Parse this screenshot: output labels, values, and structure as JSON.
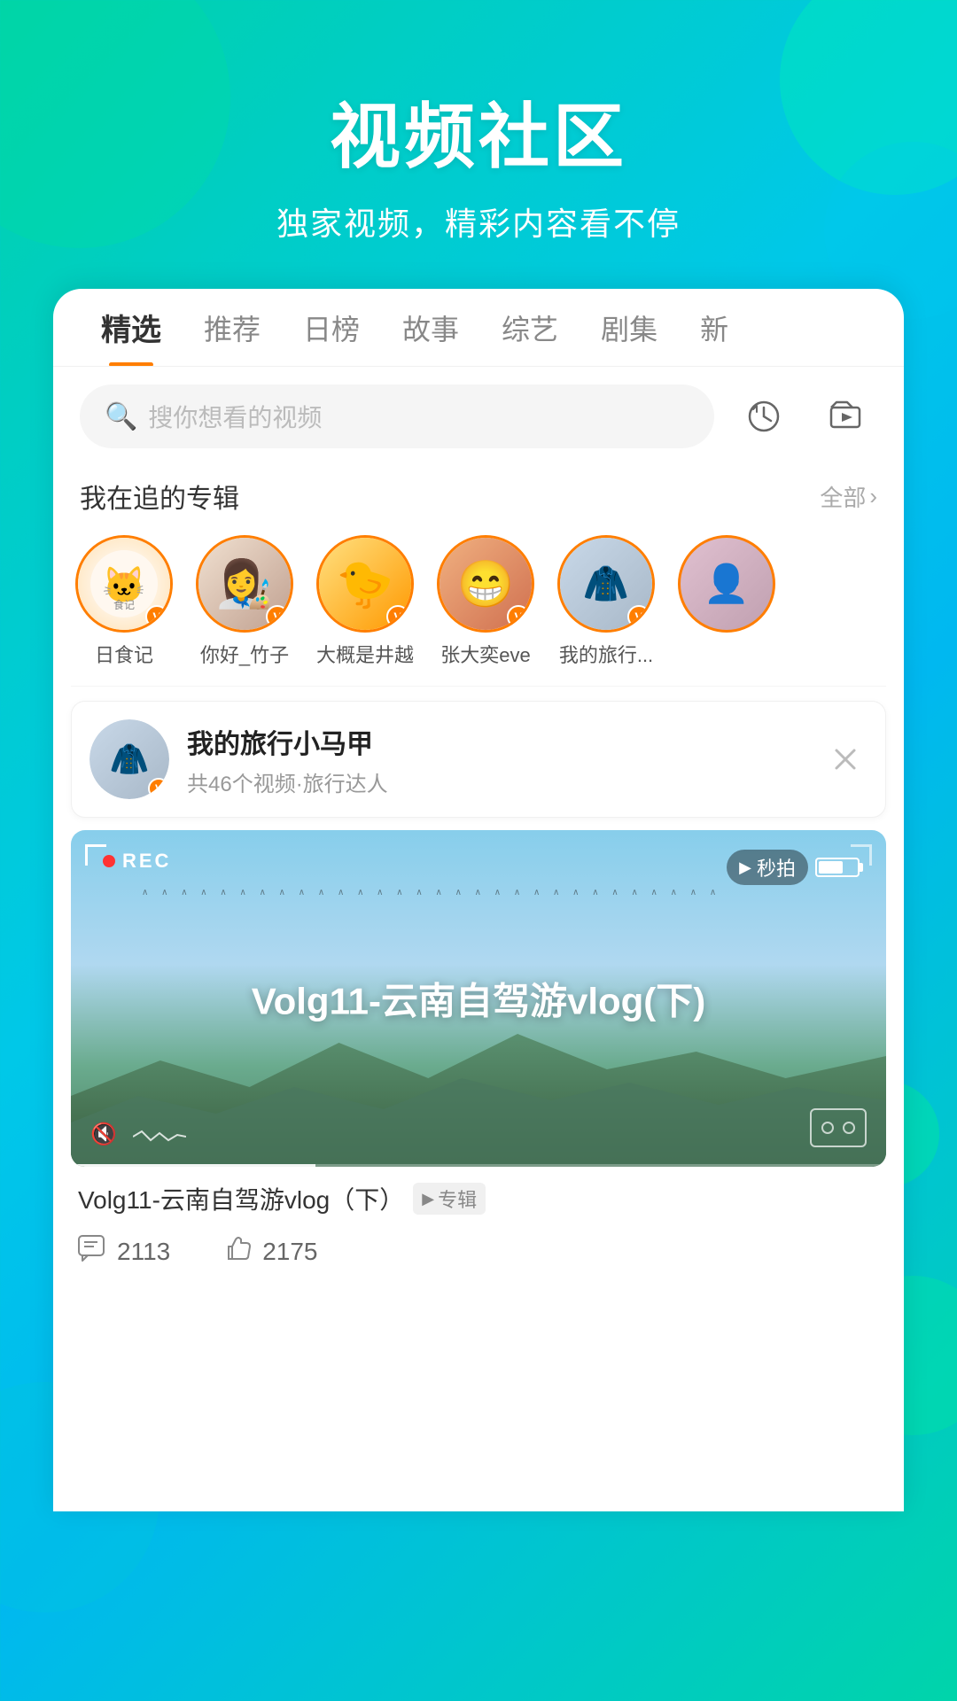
{
  "header": {
    "title": "视频社区",
    "subtitle": "独家视频，精彩内容看不停"
  },
  "tabs": [
    {
      "label": "精选",
      "active": true
    },
    {
      "label": "推荐",
      "active": false
    },
    {
      "label": "日榜",
      "active": false
    },
    {
      "label": "故事",
      "active": false
    },
    {
      "label": "综艺",
      "active": false
    },
    {
      "label": "剧集",
      "active": false
    },
    {
      "label": "新",
      "active": false
    }
  ],
  "search": {
    "placeholder": "搜你想看的视频"
  },
  "section_following": {
    "title": "我在追的专辑",
    "more_label": "全部"
  },
  "avatars": [
    {
      "name": "日食记",
      "emoji": "🐱"
    },
    {
      "name": "你好_竹子",
      "emoji": "👩"
    },
    {
      "name": "大概是井越",
      "emoji": "🐤"
    },
    {
      "name": "张大奕eve",
      "emoji": "😁"
    },
    {
      "name": "我的旅行...",
      "emoji": "🧥"
    }
  ],
  "channel": {
    "name": "我的旅行小马甲",
    "desc": "共46个视频·旅行达人"
  },
  "video": {
    "rec_label": "REC",
    "title_overlay": "Volg11-云南自驾游vlog(下)",
    "title_display": "Volg11-云南自驾游vlog（下）",
    "album_label": "专辑",
    "secondpai": "秒拍",
    "comment_count": "2113",
    "like_count": "2175"
  },
  "icons": {
    "search": "🔍",
    "history": "⏱",
    "video_folder": "📁",
    "close": "✕",
    "play": "▶",
    "comment": "💬",
    "like": "👍",
    "mute": "🔇",
    "vip": "V"
  }
}
